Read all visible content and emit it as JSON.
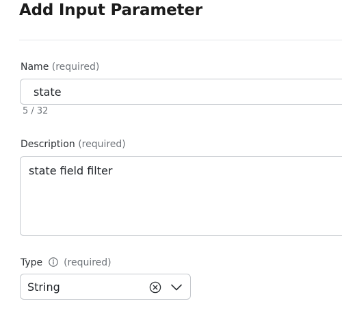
{
  "dialog": {
    "title": "Add Input Parameter"
  },
  "name_field": {
    "label": "Name",
    "required_hint": "(required)",
    "value": "state",
    "counter": "5 / 32"
  },
  "description_field": {
    "label": "Description",
    "required_hint": "(required)",
    "value": "state field filter"
  },
  "type_field": {
    "label": "Type",
    "required_hint": "(required)",
    "info_icon": "info-icon",
    "selected_value": "String",
    "clear_icon": "clear-circle-icon",
    "dropdown_icon": "chevron-down-icon"
  },
  "colors": {
    "border": "#c4c8cd",
    "muted_text": "#6f747a",
    "divider": "#e3e5e8"
  }
}
